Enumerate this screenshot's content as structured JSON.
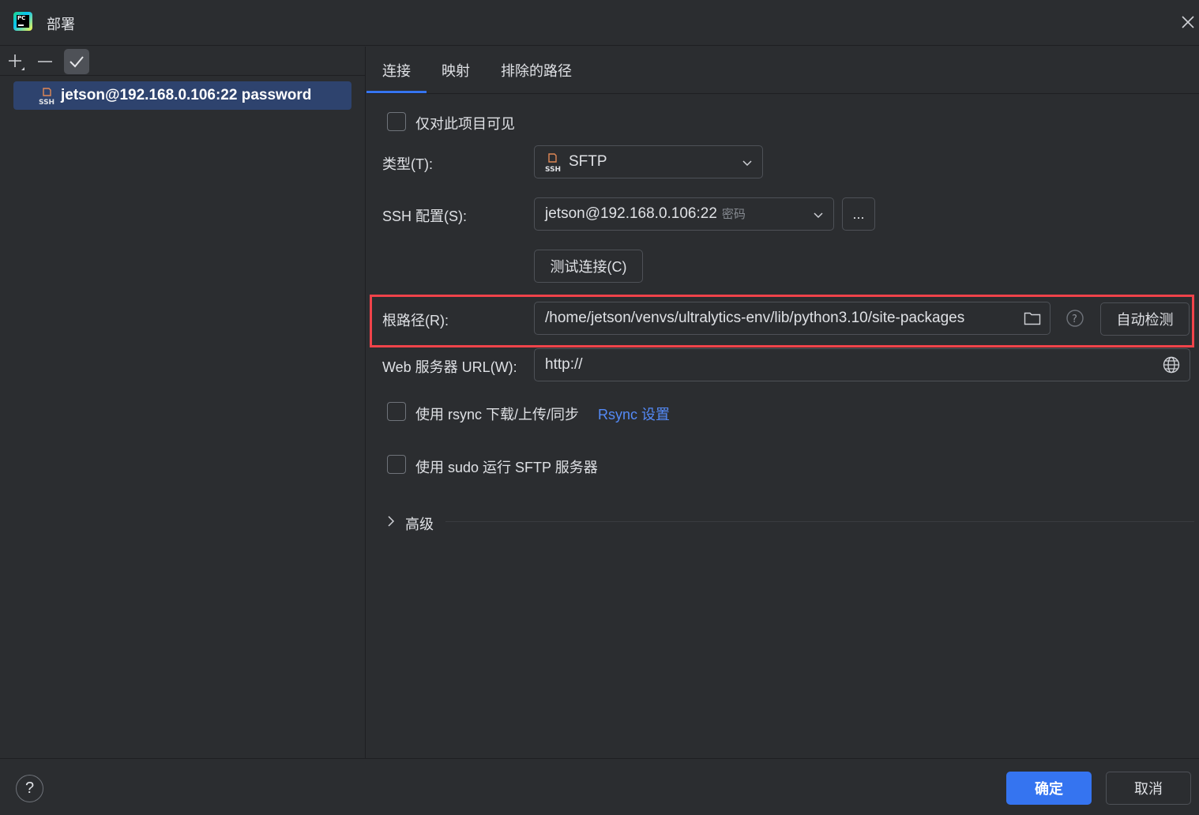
{
  "window": {
    "title": "部署"
  },
  "left": {
    "server_label": "jetson@192.168.0.106:22 password"
  },
  "tabs": [
    {
      "label": "连接"
    },
    {
      "label": "映射"
    },
    {
      "label": "排除的路径"
    }
  ],
  "form": {
    "visible_only_label": "仅对此项目可见",
    "type_label": "类型(T):",
    "type_value": "SFTP",
    "ssh_label": "SSH 配置(S):",
    "ssh_value": "jetson@192.168.0.106:22",
    "ssh_hint": "密码",
    "ssh_more": "...",
    "test_button": "测试连接(C)",
    "root_label": "根路径(R):",
    "root_value": "/home/jetson/venvs/ultralytics-env/lib/python3.10/site-packages",
    "autodetect_button": "自动检测",
    "web_label": "Web 服务器 URL(W):",
    "web_value": "http://",
    "rsync_label": "使用 rsync 下载/上传/同步",
    "rsync_link": "Rsync 设置",
    "sudo_label": "使用 sudo 运行 SFTP 服务器",
    "advanced_label": "高级"
  },
  "footer": {
    "help": "?",
    "ok": "确定",
    "cancel": "取消"
  },
  "colors": {
    "accent": "#3574f0",
    "highlight": "#f0434a",
    "link": "#548af7",
    "selection": "#2e436e"
  }
}
